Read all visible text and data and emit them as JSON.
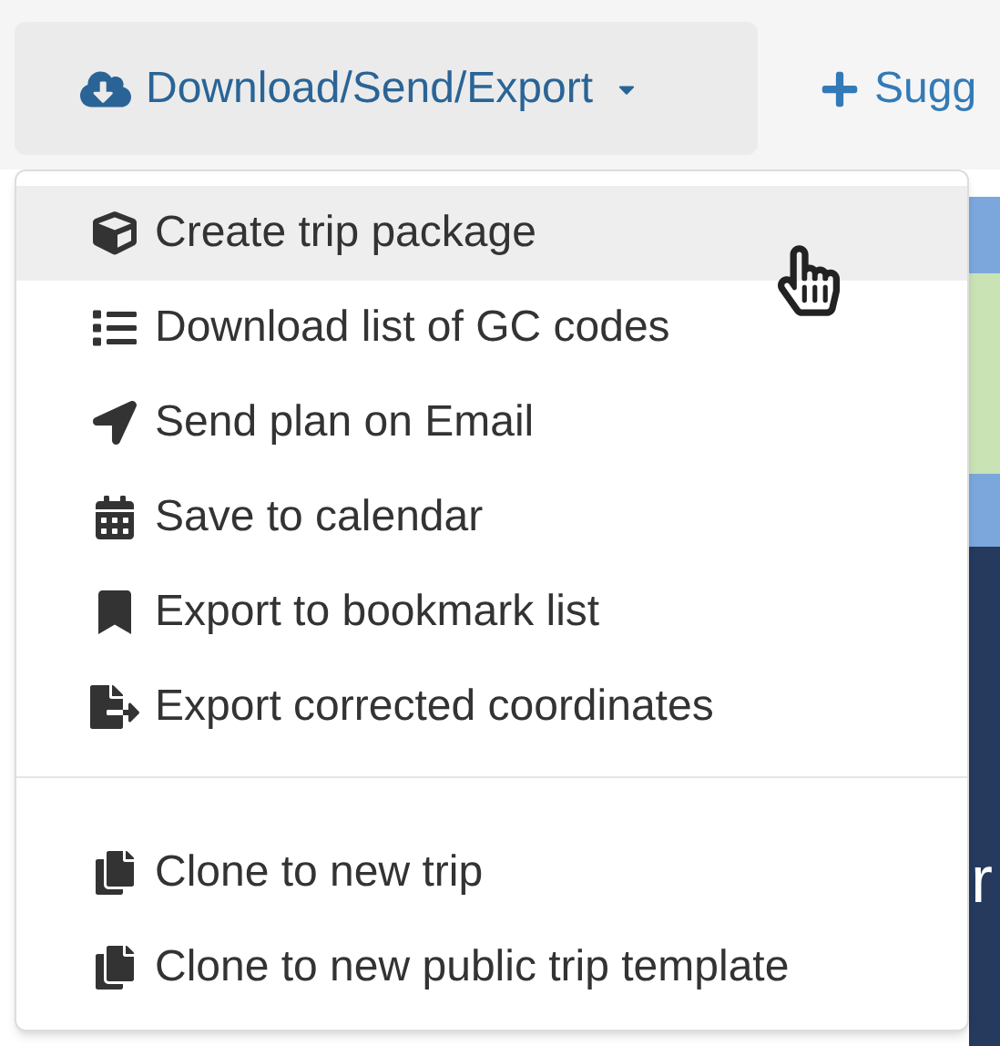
{
  "toolbar": {
    "dropdown_button": {
      "label": "Download/Send/Export"
    },
    "suggest_button": {
      "label": "Sugg"
    }
  },
  "menu": {
    "items": [
      {
        "kind": "package",
        "label": "Create trip package",
        "selected": true
      },
      {
        "kind": "list",
        "label": "Download list of GC codes",
        "selected": false
      },
      {
        "kind": "send",
        "label": "Send plan on Email",
        "selected": false
      },
      {
        "kind": "calendar",
        "label": "Save to calendar",
        "selected": false
      },
      {
        "kind": "bookmark",
        "label": "Export to bookmark list",
        "selected": false
      },
      {
        "kind": "file-export",
        "label": "Export corrected coordinates",
        "selected": false
      },
      {
        "kind": "divider"
      },
      {
        "kind": "copy",
        "label": "Clone to new trip",
        "selected": false
      },
      {
        "kind": "copy",
        "label": "Clone to new public trip template",
        "selected": false
      }
    ]
  },
  "background_text": "r"
}
